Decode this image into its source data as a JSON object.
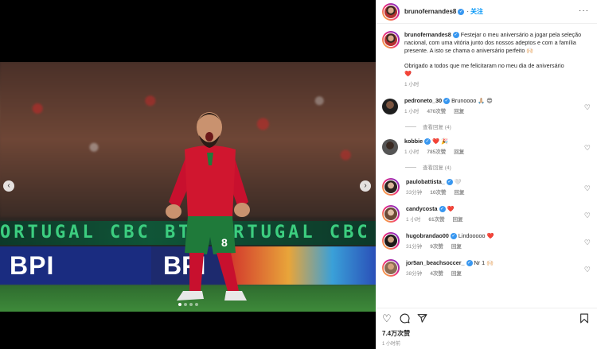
{
  "post": {
    "author": "brunofernandes8",
    "follow_label": "关注",
    "more_label": "···",
    "caption": "Festejar o meu aniversário a jogar pela seleção nacional, com uma vitória junto dos nossos adeptos e com a família presente. A isto se chama o aniversário perfeito 🙌🏻",
    "caption_line2": "Obrigado a todos que me felicitaram no meu dia de aniversário",
    "caption_heart": "❤️",
    "caption_time": "1 小时",
    "likes": "7.4万次赞",
    "time": "1 小时前"
  },
  "media": {
    "board_text": "ORTUGAL CBC BT   PORTUGAL CBC BT",
    "bpi_left": "BPI",
    "bpi_right": "BPI",
    "shirt_number": "8",
    "prev_icon": "‹",
    "next_icon": "›"
  },
  "comments": [
    {
      "user": "pedroneto_30",
      "verified": true,
      "text": "Brunoooo 🙏🏼 😍",
      "time": "1 小时",
      "likes": "470次赞",
      "reply": "回复",
      "view_replies": "查看回复 (4)"
    },
    {
      "user": "kobbie",
      "verified": true,
      "text": "❤️ 🎉",
      "time": "1 小时",
      "likes": "785次赞",
      "reply": "回复",
      "view_replies": "查看回复 (4)"
    },
    {
      "user": "paulobattista_",
      "verified": true,
      "text": "🤍",
      "time": "33分钟",
      "likes": "10次赞",
      "reply": "回复"
    },
    {
      "user": "candycosta",
      "verified": true,
      "text": "❤️",
      "time": "1 小时",
      "likes": "61次赞",
      "reply": "回复"
    },
    {
      "user": "hugobrandao00",
      "verified": true,
      "text": "Lindooooo ❤️",
      "time": "31分钟",
      "likes": "9次赞",
      "reply": "回复"
    },
    {
      "user": "jor5an_beachsoccer_",
      "verified": true,
      "text": "Nr 1 🙌🏻",
      "time": "38分钟",
      "likes": "4次赞",
      "reply": "回复"
    }
  ],
  "colors": {
    "accent": "#0095f6",
    "verified": "#3897f0",
    "heart": "#ed4956",
    "portugal_red": "#c8102e",
    "portugal_green": "#1f7a3a"
  }
}
